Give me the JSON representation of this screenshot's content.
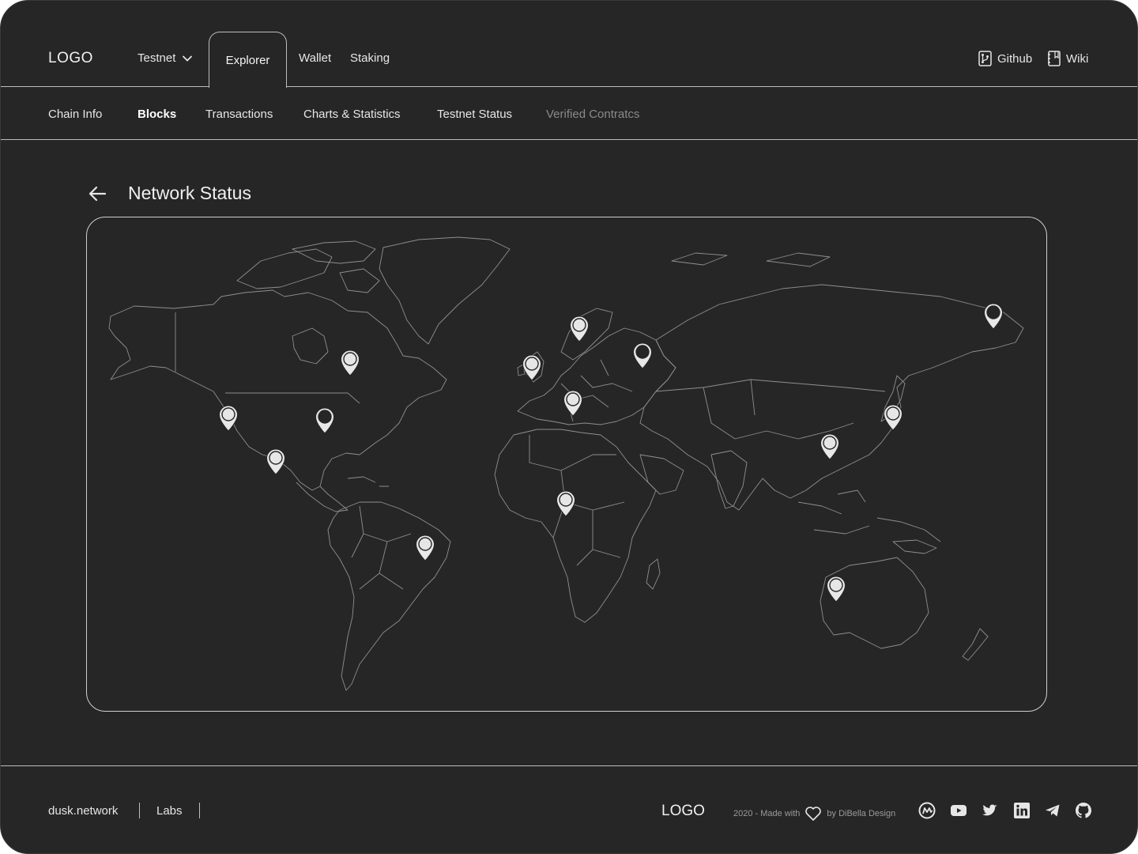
{
  "header": {
    "logo": "LOGO",
    "network_select": "Testnet",
    "tabs": [
      "Explorer",
      "Wallet",
      "Staking"
    ],
    "github_label": "Github",
    "wiki_label": "Wiki"
  },
  "subnav": {
    "items": [
      "Chain Info",
      "Blocks",
      "Transactions",
      "Charts & Statistics",
      "Testnet Status",
      "Verified Contratcs"
    ],
    "active": "Blocks"
  },
  "page": {
    "title": "Network Status"
  },
  "map": {
    "pins": [
      {
        "name": "north-america-canada",
        "status": "active"
      },
      {
        "name": "us-west",
        "status": "active"
      },
      {
        "name": "us-east",
        "status": "inactive"
      },
      {
        "name": "mexico",
        "status": "active"
      },
      {
        "name": "brazil",
        "status": "active"
      },
      {
        "name": "ireland",
        "status": "active"
      },
      {
        "name": "scandinavia",
        "status": "active"
      },
      {
        "name": "russia",
        "status": "inactive"
      },
      {
        "name": "central-europe",
        "status": "active"
      },
      {
        "name": "west-africa",
        "status": "active"
      },
      {
        "name": "china",
        "status": "active"
      },
      {
        "name": "japan",
        "status": "active"
      },
      {
        "name": "russia-far-east",
        "status": "inactive"
      },
      {
        "name": "australia",
        "status": "active"
      }
    ]
  },
  "footer": {
    "links": [
      "dusk.network",
      "Labs"
    ],
    "logo": "LOGO",
    "credit_prefix": "2020  - Made with",
    "credit_suffix": "by DiBella Design",
    "social_icons": [
      "coinmarketcap-icon",
      "youtube-icon",
      "twitter-icon",
      "linkedin-icon",
      "telegram-icon",
      "github-icon"
    ]
  },
  "colors": {
    "background": "#262626",
    "border": "#bdbdbd",
    "pin_active": "#e6e6e6",
    "pin_inactive": "#262626"
  }
}
